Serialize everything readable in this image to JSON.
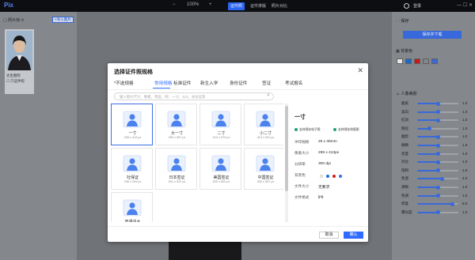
{
  "app": {
    "logo": "Pix"
  },
  "toolbar": {
    "zoom": "100%",
    "minus": "−",
    "plus": "+",
    "tabs": [
      {
        "label": "证件照",
        "active": true
      },
      {
        "label": "证件排版",
        "active": false
      },
      {
        "label": "照片对比",
        "active": false
      }
    ],
    "user": "登录",
    "window_controls": "— ☐ ✕"
  },
  "left_panel": {
    "title": "照片库",
    "import": "+导入图片",
    "thumb_caption": "太生图例",
    "thumb_check": "只证件照"
  },
  "right_panel": {
    "save_title": "保存",
    "save_button": "保存并下载",
    "bg_title": "背景色",
    "beauty_title": "人像美颜",
    "sliders": [
      {
        "label": "磨皮",
        "value": "1.0",
        "level": 0.5
      },
      {
        "label": "美白",
        "value": "1.0",
        "level": 0.5
      },
      {
        "label": "红润",
        "value": "1.0",
        "level": 0.5
      },
      {
        "label": "锐化",
        "value": "1.0",
        "level": 0.3
      },
      {
        "label": "瘦脸",
        "value": "1.0",
        "level": 0.5
      },
      {
        "label": "眼睛",
        "value": "1.0",
        "level": 0.5
      },
      {
        "label": "亮度",
        "value": "1.0",
        "level": 0.5
      },
      {
        "label": "对比",
        "value": "1.0",
        "level": 0.5
      },
      {
        "label": "饱和",
        "value": "1.0",
        "level": 0.5
      },
      {
        "label": "色温",
        "value": "4.0",
        "level": 0.6
      },
      {
        "label": "清晰",
        "value": "1.0",
        "level": 0.5
      },
      {
        "label": "色调",
        "value": "1.0",
        "level": 0.5
      },
      {
        "label": "修复",
        "value": "8.0",
        "level": 0.85
      },
      {
        "label": "曝光度",
        "value": "1.0",
        "level": 0.5
      }
    ],
    "bg_colors": [
      "#f4f4f4",
      "#1b6fd6",
      "#d21d1d",
      "#8a8d91",
      "#3b6fe8"
    ]
  },
  "dialog": {
    "title": "选择证件照规格",
    "close": "✕",
    "tabs": [
      "*不选规格",
      "常用规格",
      "标准证件",
      "新生入学",
      "身份证件",
      "签证",
      "考试报名"
    ],
    "active_tab": 1,
    "search_placeholder": "输入照片尺寸，像素，用途。例：一寸，413，身份证等",
    "specs": [
      {
        "name": "一寸",
        "size": "295 x 413 px"
      },
      {
        "name": "大一寸",
        "size": "390 x 567 px"
      },
      {
        "name": "二寸",
        "size": "413 x 579 px"
      },
      {
        "name": "小二寸",
        "size": "413 x 531 px"
      },
      {
        "name": "社保证",
        "size": "236 x 295 px"
      },
      {
        "name": "日本签证",
        "size": "531 x 531 px"
      },
      {
        "name": "美国签证",
        "size": "600 x 600 px"
      },
      {
        "name": "中国签证",
        "size": "390 x 567 px"
      },
      {
        "name": "普通话水",
        "size": "390 x 567 px"
      }
    ],
    "detail": {
      "title": "一寸",
      "support1": "支持保存电子照",
      "support2": "支持保存排版照",
      "rows": [
        {
          "label": "冲印规格",
          "value": "25 x 35mm"
        },
        {
          "label": "像素大小",
          "value": "295 x 413px"
        },
        {
          "label": "分辨率",
          "value": "300 dpi"
        },
        {
          "label": "背景色",
          "value": ""
        },
        {
          "label": "文件大小",
          "value": "无要求"
        },
        {
          "label": "文件格式",
          "value": "jpg"
        }
      ],
      "bg_swatches": [
        "#ffffff",
        "#1b6fd6",
        "#d21d1d",
        "#3b6fe8"
      ]
    },
    "cancel": "取消",
    "ok": "确认"
  }
}
